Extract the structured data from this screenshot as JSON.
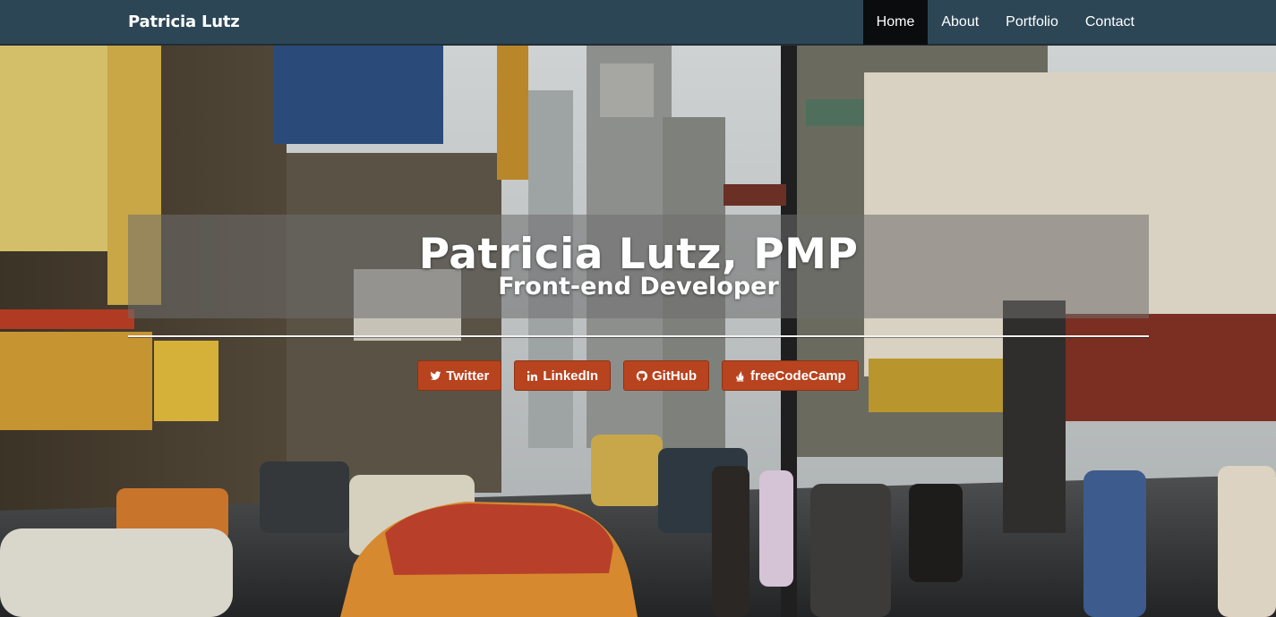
{
  "navbar": {
    "brand": "Patricia Lutz",
    "items": [
      {
        "label": "Home",
        "active": true
      },
      {
        "label": "About",
        "active": false
      },
      {
        "label": "Portfolio",
        "active": false
      },
      {
        "label": "Contact",
        "active": false
      }
    ]
  },
  "hero": {
    "title": "Patricia Lutz, PMP",
    "subtitle": "Front-end Developer",
    "background_image": "vintage Times Square street scene photograph"
  },
  "social_links": [
    {
      "label": "Twitter",
      "icon": "twitter-icon"
    },
    {
      "label": "LinkedIn",
      "icon": "linkedin-icon"
    },
    {
      "label": "GitHub",
      "icon": "github-icon"
    },
    {
      "label": "freeCodeCamp",
      "icon": "fire-icon"
    }
  ],
  "colors": {
    "navbar_bg": "#2c4656",
    "nav_active_bg": "#0a0c0d",
    "button_bg": "#b8431f",
    "text": "#ffffff"
  }
}
